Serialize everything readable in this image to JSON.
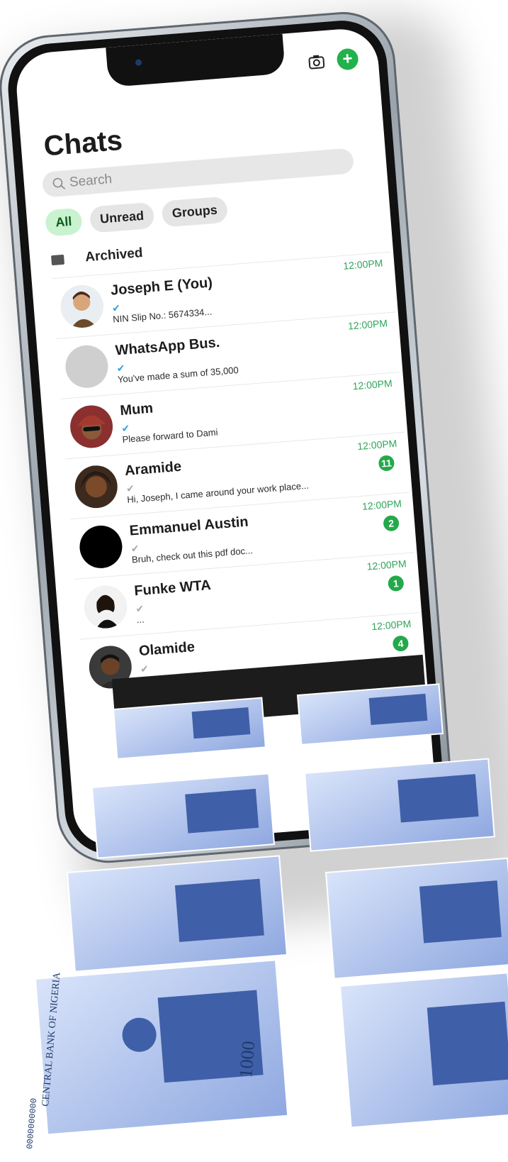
{
  "header": {
    "title": "Chats",
    "camera_icon": "camera-icon",
    "new_chat_icon": "plus-icon",
    "new_chat_label": "+"
  },
  "search": {
    "placeholder": "Search"
  },
  "filters": [
    {
      "label": "All",
      "active": true
    },
    {
      "label": "Unread",
      "active": false
    },
    {
      "label": "Groups",
      "active": false
    }
  ],
  "archived": {
    "label": "Archived"
  },
  "chats": [
    {
      "name": "Joseph E (You)",
      "time": "12:00PM",
      "preview": "NIN Slip No.: 5674334...",
      "tick": "✔",
      "badge": ""
    },
    {
      "name": "WhatsApp Bus.",
      "time": "12:00PM",
      "preview": "You've made a sum of 35,000",
      "tick": "✔",
      "badge": ""
    },
    {
      "name": "Mum",
      "time": "12:00PM",
      "preview": "Please forward to Dami",
      "tick": "✔",
      "badge": ""
    },
    {
      "name": "Aramide",
      "time": "12:00PM",
      "preview": "Hi, Joseph, I came around your work place...",
      "tick": "✔",
      "badge": "11"
    },
    {
      "name": "Emmanuel Austin",
      "time": "12:00PM",
      "preview": "Bruh, check out this pdf doc...",
      "tick": "✔",
      "badge": "2"
    },
    {
      "name": "Funke WTA",
      "time": "12:00PM",
      "preview": "...",
      "tick": "✔",
      "badge": "1"
    },
    {
      "name": "Olamide",
      "time": "12:00PM",
      "preview": "...",
      "tick": "✔",
      "badge": "4"
    }
  ],
  "banknote": {
    "text_bank": "CENTRAL BANK OF NIGERIA",
    "denomination": "1000",
    "serial": "0000000000"
  },
  "colors": {
    "accent": "#23b14d",
    "time": "#2fa55a",
    "read_tick": "#35a0e3",
    "note_blue": "#3f5fa8"
  }
}
